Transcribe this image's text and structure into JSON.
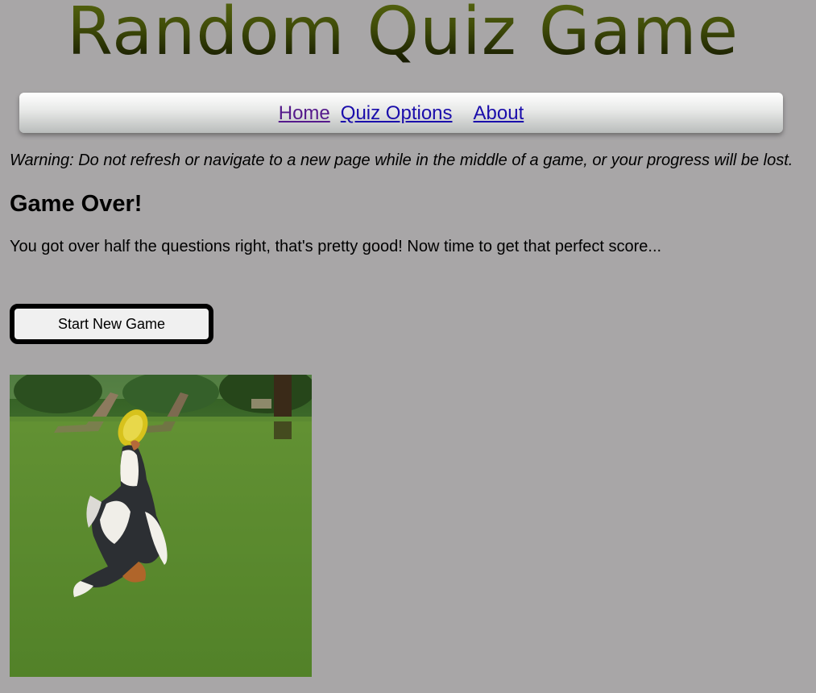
{
  "header": {
    "title": "Random Quiz Game"
  },
  "nav": {
    "items": [
      {
        "label": "Home"
      },
      {
        "label": "Quiz Options"
      },
      {
        "label": "About"
      }
    ]
  },
  "main": {
    "warning": "Warning: Do not refresh or navigate to a new page while in the middle of a game, or your progress will be lost.",
    "heading": "Game Over!",
    "result_message": "You got over half the questions right, that's pretty good! Now time to get that perfect score...",
    "start_button_label": "Start New Game",
    "image_subject": "dog catching frisbee on grass"
  },
  "colors": {
    "page_background": "#a8a6a7",
    "link": "#1a0dab",
    "visited_link": "#551a8b",
    "title_gradient_top": "#5a6a10",
    "title_gradient_bottom": "#0c0e00"
  }
}
